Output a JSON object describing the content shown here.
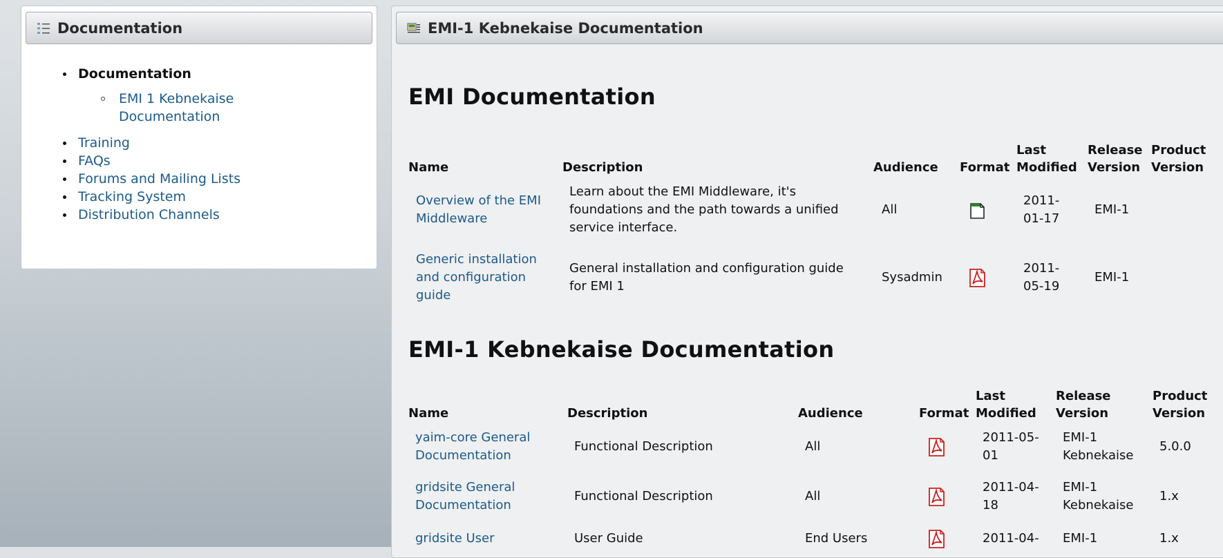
{
  "sidebar": {
    "title": "Documentation",
    "items": [
      {
        "label": "Documentation",
        "current": true,
        "children": [
          {
            "label": "EMI 1 Kebnekaise Documentation"
          }
        ]
      },
      {
        "label": "Training"
      },
      {
        "label": "FAQs"
      },
      {
        "label": "Forums and Mailing Lists"
      },
      {
        "label": "Tracking System"
      },
      {
        "label": "Distribution Channels"
      }
    ]
  },
  "main": {
    "title": "EMI-1 Kebnekaise Documentation",
    "section1": {
      "heading": "EMI Documentation",
      "columns": [
        "Name",
        "Description",
        "Audience",
        "Format",
        "Last Modified",
        "Release Version",
        "Product Version"
      ],
      "rows": [
        {
          "name": "Overview of the EMI Middleware",
          "description": "Learn about the EMI Middleware, it's foundations and the path towards a unified service interface.",
          "audience": "All",
          "format": "document-icon",
          "last_modified": "2011-01-17",
          "release_version": "EMI-1",
          "product_version": ""
        },
        {
          "name": "Generic installation and configuration guide",
          "description": "General installation and configuration guide for EMI 1",
          "audience": "Sysadmin",
          "format": "pdf-icon",
          "last_modified": "2011-05-19",
          "release_version": "EMI-1",
          "product_version": ""
        }
      ]
    },
    "section2": {
      "heading": "EMI-1 Kebnekaise Documentation",
      "columns": [
        "Name",
        "Description",
        "Audience",
        "Format",
        "Last Modified",
        "Release Version",
        "Product Version"
      ],
      "rows": [
        {
          "name": "yaim-core General Documentation",
          "description": "Functional Description",
          "audience": "All",
          "format": "pdf-icon",
          "last_modified": "2011-05-01",
          "release_version": "EMI-1 Kebnekaise",
          "product_version": "5.0.0"
        },
        {
          "name": "gridsite General Documentation",
          "description": "Functional Description",
          "audience": "All",
          "format": "pdf-icon",
          "last_modified": "2011-04-18",
          "release_version": "EMI-1 Kebnekaise",
          "product_version": "1.x"
        },
        {
          "name": "gridsite User",
          "description": "User Guide",
          "audience": "End Users",
          "format": "pdf-icon",
          "last_modified": "2011-04-",
          "release_version": "EMI-1",
          "product_version": "1.x"
        }
      ]
    }
  },
  "colors": {
    "link": "#1b5a8c",
    "pdf_red": "#cc1f1f"
  }
}
